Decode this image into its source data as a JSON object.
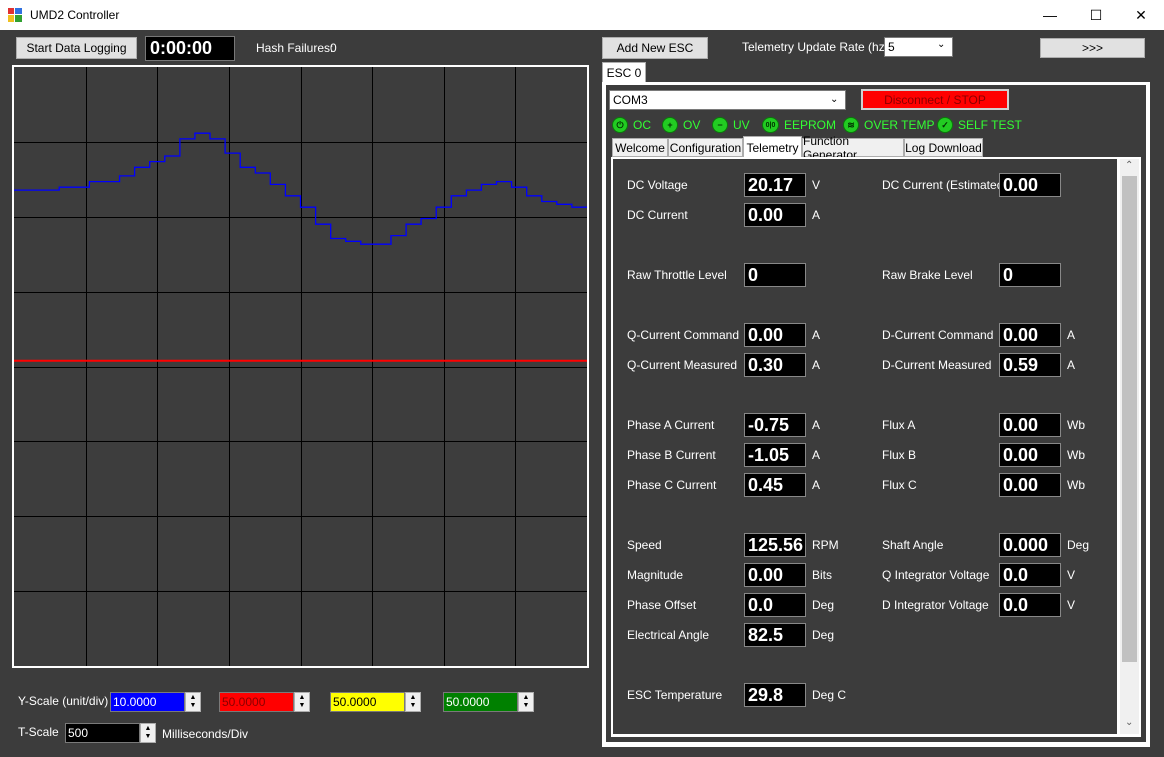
{
  "window": {
    "title": "UMD2 Controller",
    "minimize": "—",
    "maximize": "☐",
    "close": "✕"
  },
  "toolbar": {
    "start_logging": "Start Data Logging",
    "timer": "0:00:00",
    "hash_failures_label": "Hash Failures:",
    "hash_failures_value": "0",
    "add_esc": "Add New ESC",
    "telemetry_rate_label": "Telemetry Update Rate (hz):",
    "telemetry_rate_value": "5",
    "more_button": ">>>"
  },
  "scales": {
    "yscale_label": "Y-Scale (unit/div)",
    "channels": [
      {
        "value": "10.0000",
        "color": "#0000ff"
      },
      {
        "value": "50.0000",
        "color": "#ff0000"
      },
      {
        "value": "50.0000",
        "color": "#ffff00"
      },
      {
        "value": "50.0000",
        "color": "#008000"
      }
    ],
    "tscale_label": "T-Scale",
    "tscale_value": "500",
    "tscale_unit": "Milliseconds/Div"
  },
  "chart_data": {
    "type": "line",
    "grid_divisions": {
      "x": 8,
      "y": 8
    },
    "series": [
      {
        "color": "#0000ff",
        "values": [
          0.62,
          0.62,
          0.62,
          0.63,
          0.63,
          0.65,
          0.65,
          0.67,
          0.7,
          0.72,
          0.74,
          0.8,
          0.82,
          0.8,
          0.75,
          0.7,
          0.68,
          0.64,
          0.6,
          0.56,
          0.5,
          0.45,
          0.44,
          0.43,
          0.43,
          0.46,
          0.5,
          0.52,
          0.56,
          0.6,
          0.62,
          0.64,
          0.65,
          0.63,
          0.6,
          0.58,
          0.57,
          0.56,
          0.56
        ]
      },
      {
        "color": "#ff0000",
        "values": [
          0.02,
          0.02,
          0.02,
          0.02,
          0.02,
          0.02,
          0.02,
          0.02,
          0.02,
          0.02,
          0.02,
          0.02,
          0.02,
          0.02,
          0.02,
          0.02,
          0.02,
          0.02,
          0.02,
          0.02,
          0.02,
          0.02,
          0.02,
          0.02,
          0.02,
          0.02,
          0.02,
          0.02,
          0.02,
          0.02,
          0.02,
          0.02,
          0.02,
          0.02,
          0.02,
          0.02,
          0.02,
          0.02,
          0.02
        ]
      }
    ]
  },
  "esc": {
    "tab_label": "ESC 0",
    "com_port": "COM3",
    "disconnect": "Disconnect / STOP",
    "status": [
      {
        "icon": "power-icon",
        "glyph": "⏻",
        "label": "OC"
      },
      {
        "icon": "plus-icon",
        "glyph": "+",
        "label": "OV"
      },
      {
        "icon": "minus-icon",
        "glyph": "−",
        "label": "UV"
      },
      {
        "icon": "binary-icon",
        "glyph": "0|0",
        "label": "EEPROM"
      },
      {
        "icon": "heat-icon",
        "glyph": "≋",
        "label": "OVER TEMP"
      },
      {
        "icon": "check-icon",
        "glyph": "✓",
        "label": "SELF TEST"
      }
    ],
    "tabs": [
      "Welcome",
      "Configuration",
      "Telemetry",
      "Function Generator",
      "Log Download"
    ],
    "active_tab": "Telemetry"
  },
  "telemetry": {
    "dc_voltage": {
      "label": "DC Voltage",
      "value": "20.17",
      "unit": "V"
    },
    "dc_current_est": {
      "label": "DC Current (Estimated)",
      "value": "0.00",
      "unit": ""
    },
    "dc_current": {
      "label": "DC Current",
      "value": "0.00",
      "unit": "A"
    },
    "raw_throttle": {
      "label": "Raw Throttle Level",
      "value": "0",
      "unit": ""
    },
    "raw_brake": {
      "label": "Raw Brake Level",
      "value": "0",
      "unit": ""
    },
    "q_current_cmd": {
      "label": "Q-Current Command",
      "value": "0.00",
      "unit": "A"
    },
    "d_current_cmd": {
      "label": "D-Current Command",
      "value": "0.00",
      "unit": "A"
    },
    "q_current_meas": {
      "label": "Q-Current Measured",
      "value": "0.30",
      "unit": "A"
    },
    "d_current_meas": {
      "label": "D-Current Measured",
      "value": "0.59",
      "unit": "A"
    },
    "phase_a": {
      "label": "Phase A Current",
      "value": "-0.75",
      "unit": "A"
    },
    "flux_a": {
      "label": "Flux A",
      "value": "0.00",
      "unit": "Wb"
    },
    "phase_b": {
      "label": "Phase B Current",
      "value": "-1.05",
      "unit": "A"
    },
    "flux_b": {
      "label": "Flux B",
      "value": "0.00",
      "unit": "Wb"
    },
    "phase_c": {
      "label": "Phase C Current",
      "value": "0.45",
      "unit": "A"
    },
    "flux_c": {
      "label": "Flux C",
      "value": "0.00",
      "unit": "Wb"
    },
    "speed": {
      "label": "Speed",
      "value": "125.56",
      "unit": "RPM"
    },
    "shaft_angle": {
      "label": "Shaft Angle",
      "value": "0.000",
      "unit": "Deg"
    },
    "magnitude": {
      "label": "Magnitude",
      "value": "0.00",
      "unit": "Bits"
    },
    "q_integrator": {
      "label": "Q Integrator Voltage",
      "value": "0.0",
      "unit": "V"
    },
    "phase_offset": {
      "label": "Phase Offset",
      "value": "0.0",
      "unit": "Deg"
    },
    "d_integrator": {
      "label": "D Integrator Voltage",
      "value": "0.0",
      "unit": "V"
    },
    "electrical_angle": {
      "label": "Electrical Angle",
      "value": "82.5",
      "unit": "Deg"
    },
    "esc_temp": {
      "label": "ESC Temperature",
      "value": "29.8",
      "unit": "Deg C"
    }
  }
}
